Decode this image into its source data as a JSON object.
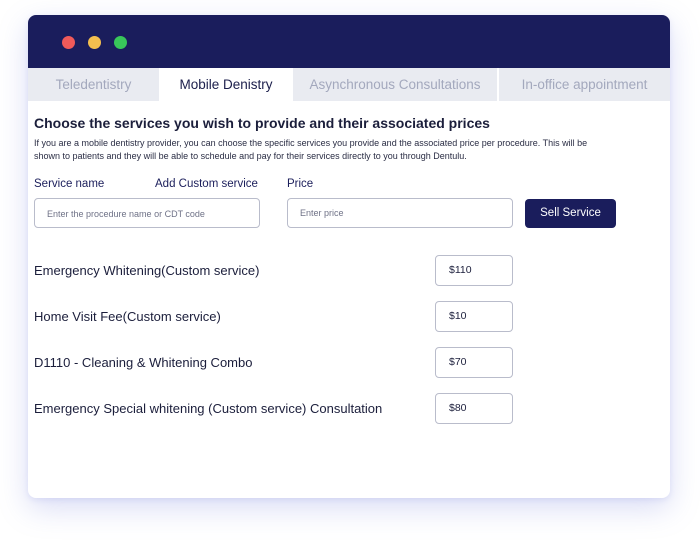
{
  "tabs": [
    {
      "label": "Teledentistry",
      "active": false
    },
    {
      "label": "Mobile Denistry",
      "active": true
    },
    {
      "label": "Asynchronous Consultations",
      "active": false
    },
    {
      "label": "In-office appointment",
      "active": false
    }
  ],
  "section": {
    "heading": "Choose the services you wish to provide and their associated prices",
    "description": "If you are a mobile dentistry provider, you can choose the specific services you provide and the associated price per procedure. This will be shown to patients and they will be able to schedule and pay for their services directly to you through Dentulu."
  },
  "form": {
    "service_label": "Service name",
    "custom_label": "Add Custom service",
    "price_label": "Price",
    "service_placeholder": "Enter the procedure name  or CDT code",
    "price_placeholder": "Enter price",
    "submit_label": "Sell Service"
  },
  "services": [
    {
      "name": "Emergency Whitening(Custom service)",
      "price": "$110"
    },
    {
      "name": "Home Visit Fee(Custom service)",
      "price": "$10"
    },
    {
      "name": "D1110 - Cleaning & Whitening Combo",
      "price": "$70"
    },
    {
      "name": "Emergency Special whitening (Custom service) Consultation",
      "price": "$80"
    }
  ],
  "colors": {
    "titlebar": "#1a1d5c",
    "accent_button": "#1a1d5c",
    "traffic_red": "#f05a5a",
    "traffic_yellow": "#f4bf4f",
    "traffic_green": "#38c65a"
  }
}
